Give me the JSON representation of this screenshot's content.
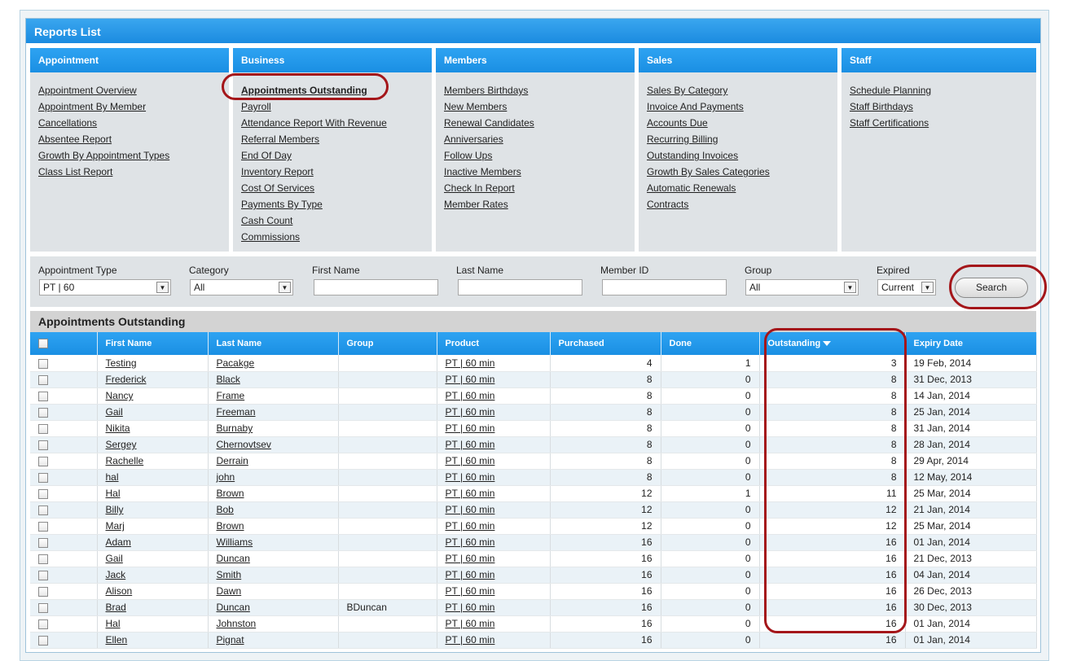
{
  "window_title": "Reports List",
  "categories": [
    {
      "header": "Appointment",
      "links": [
        "Appointment Overview",
        "Appointment By Member",
        "Cancellations",
        "Absentee Report",
        "Growth By Appointment Types",
        "Class List Report"
      ]
    },
    {
      "header": "Business",
      "links": [
        "Appointments Outstanding",
        "Payroll",
        "Attendance Report With Revenue",
        "Referral Members",
        "End Of Day",
        "Inventory Report",
        "Cost Of Services",
        "Payments By Type",
        "Cash Count",
        "Commissions"
      ]
    },
    {
      "header": "Members",
      "links": [
        "Members Birthdays",
        "New Members",
        "Renewal Candidates",
        "Anniversaries",
        "Follow Ups",
        "Inactive Members",
        "Check In Report",
        "Member Rates"
      ]
    },
    {
      "header": "Sales",
      "links": [
        "Sales By Category",
        "Invoice And Payments",
        "Accounts Due",
        "Recurring Billing",
        "Outstanding Invoices",
        "Growth By Sales Categories",
        "Automatic Renewals",
        "Contracts"
      ]
    },
    {
      "header": "Staff",
      "links": [
        "Schedule Planning",
        "Staff Birthdays",
        "Staff Certifications"
      ]
    }
  ],
  "filters": {
    "appointment_type_label": "Appointment Type",
    "appointment_type_value": "PT | 60",
    "category_label": "Category",
    "category_value": "All",
    "first_name_label": "First Name",
    "first_name_value": "",
    "last_name_label": "Last Name",
    "last_name_value": "",
    "member_id_label": "Member ID",
    "member_id_value": "",
    "group_label": "Group",
    "group_value": "All",
    "expired_label": "Expired",
    "expired_value": "Current",
    "search_label": "Search"
  },
  "section_title": "Appointments Outstanding",
  "table": {
    "columns": [
      "",
      "First Name",
      "Last Name",
      "Group",
      "Product",
      "Purchased",
      "Done",
      "Outstanding",
      "Expiry Date"
    ],
    "sorted_column": "Outstanding",
    "rows": [
      {
        "first": "Testing",
        "last": "Pacakge",
        "group": "",
        "product": "PT | 60 min",
        "purchased": "4",
        "done": "1",
        "outstanding": "3",
        "expiry": "19 Feb, 2014"
      },
      {
        "first": "Frederick",
        "last": "Black",
        "group": "",
        "product": "PT | 60 min",
        "purchased": "8",
        "done": "0",
        "outstanding": "8",
        "expiry": "31 Dec, 2013"
      },
      {
        "first": "Nancy",
        "last": "Frame",
        "group": "",
        "product": "PT | 60 min",
        "purchased": "8",
        "done": "0",
        "outstanding": "8",
        "expiry": "14 Jan, 2014"
      },
      {
        "first": "Gail",
        "last": "Freeman",
        "group": "",
        "product": "PT | 60 min",
        "purchased": "8",
        "done": "0",
        "outstanding": "8",
        "expiry": "25 Jan, 2014"
      },
      {
        "first": "Nikita",
        "last": "Burnaby",
        "group": "",
        "product": "PT | 60 min",
        "purchased": "8",
        "done": "0",
        "outstanding": "8",
        "expiry": "31 Jan, 2014"
      },
      {
        "first": "Sergey",
        "last": "Chernovtsev",
        "group": "",
        "product": "PT | 60 min",
        "purchased": "8",
        "done": "0",
        "outstanding": "8",
        "expiry": "28 Jan, 2014"
      },
      {
        "first": "Rachelle",
        "last": "Derrain",
        "group": "",
        "product": "PT | 60 min",
        "purchased": "8",
        "done": "0",
        "outstanding": "8",
        "expiry": "29 Apr, 2014"
      },
      {
        "first": "hal",
        "last": "john",
        "group": "",
        "product": "PT | 60 min",
        "purchased": "8",
        "done": "0",
        "outstanding": "8",
        "expiry": "12 May, 2014"
      },
      {
        "first": "Hal",
        "last": "Brown",
        "group": "",
        "product": "PT | 60 min",
        "purchased": "12",
        "done": "1",
        "outstanding": "11",
        "expiry": "25 Mar, 2014"
      },
      {
        "first": "Billy",
        "last": "Bob",
        "group": "",
        "product": "PT | 60 min",
        "purchased": "12",
        "done": "0",
        "outstanding": "12",
        "expiry": "21 Jan, 2014"
      },
      {
        "first": "Marj",
        "last": "Brown",
        "group": "",
        "product": "PT | 60 min",
        "purchased": "12",
        "done": "0",
        "outstanding": "12",
        "expiry": "25 Mar, 2014"
      },
      {
        "first": "Adam",
        "last": "Williams",
        "group": "",
        "product": "PT | 60 min",
        "purchased": "16",
        "done": "0",
        "outstanding": "16",
        "expiry": "01 Jan, 2014"
      },
      {
        "first": "Gail",
        "last": "Duncan",
        "group": "",
        "product": "PT | 60 min",
        "purchased": "16",
        "done": "0",
        "outstanding": "16",
        "expiry": "21 Dec, 2013"
      },
      {
        "first": "Jack",
        "last": "Smith",
        "group": "",
        "product": "PT | 60 min",
        "purchased": "16",
        "done": "0",
        "outstanding": "16",
        "expiry": "04 Jan, 2014"
      },
      {
        "first": "Alison",
        "last": "Dawn",
        "group": "",
        "product": "PT | 60 min",
        "purchased": "16",
        "done": "0",
        "outstanding": "16",
        "expiry": "26 Dec, 2013"
      },
      {
        "first": "Brad",
        "last": "Duncan",
        "group": "BDuncan",
        "product": "PT | 60 min",
        "purchased": "16",
        "done": "0",
        "outstanding": "16",
        "expiry": "30 Dec, 2013"
      },
      {
        "first": "Hal",
        "last": "Johnston",
        "group": "",
        "product": "PT | 60 min",
        "purchased": "16",
        "done": "0",
        "outstanding": "16",
        "expiry": "01 Jan, 2014"
      },
      {
        "first": "Ellen",
        "last": "Pignat",
        "group": "",
        "product": "PT | 60 min",
        "purchased": "16",
        "done": "0",
        "outstanding": "16",
        "expiry": "01 Jan, 2014"
      }
    ]
  },
  "colors": {
    "header_blue": "#1a8fe3",
    "highlight_ring": "#a4161a",
    "panel_grey": "#dfe3e6",
    "row_alt": "#eaf2f7"
  },
  "icons": {
    "dropdown": "chevron-down-icon",
    "sort": "sort-desc-icon",
    "checkbox": "checkbox-icon"
  }
}
